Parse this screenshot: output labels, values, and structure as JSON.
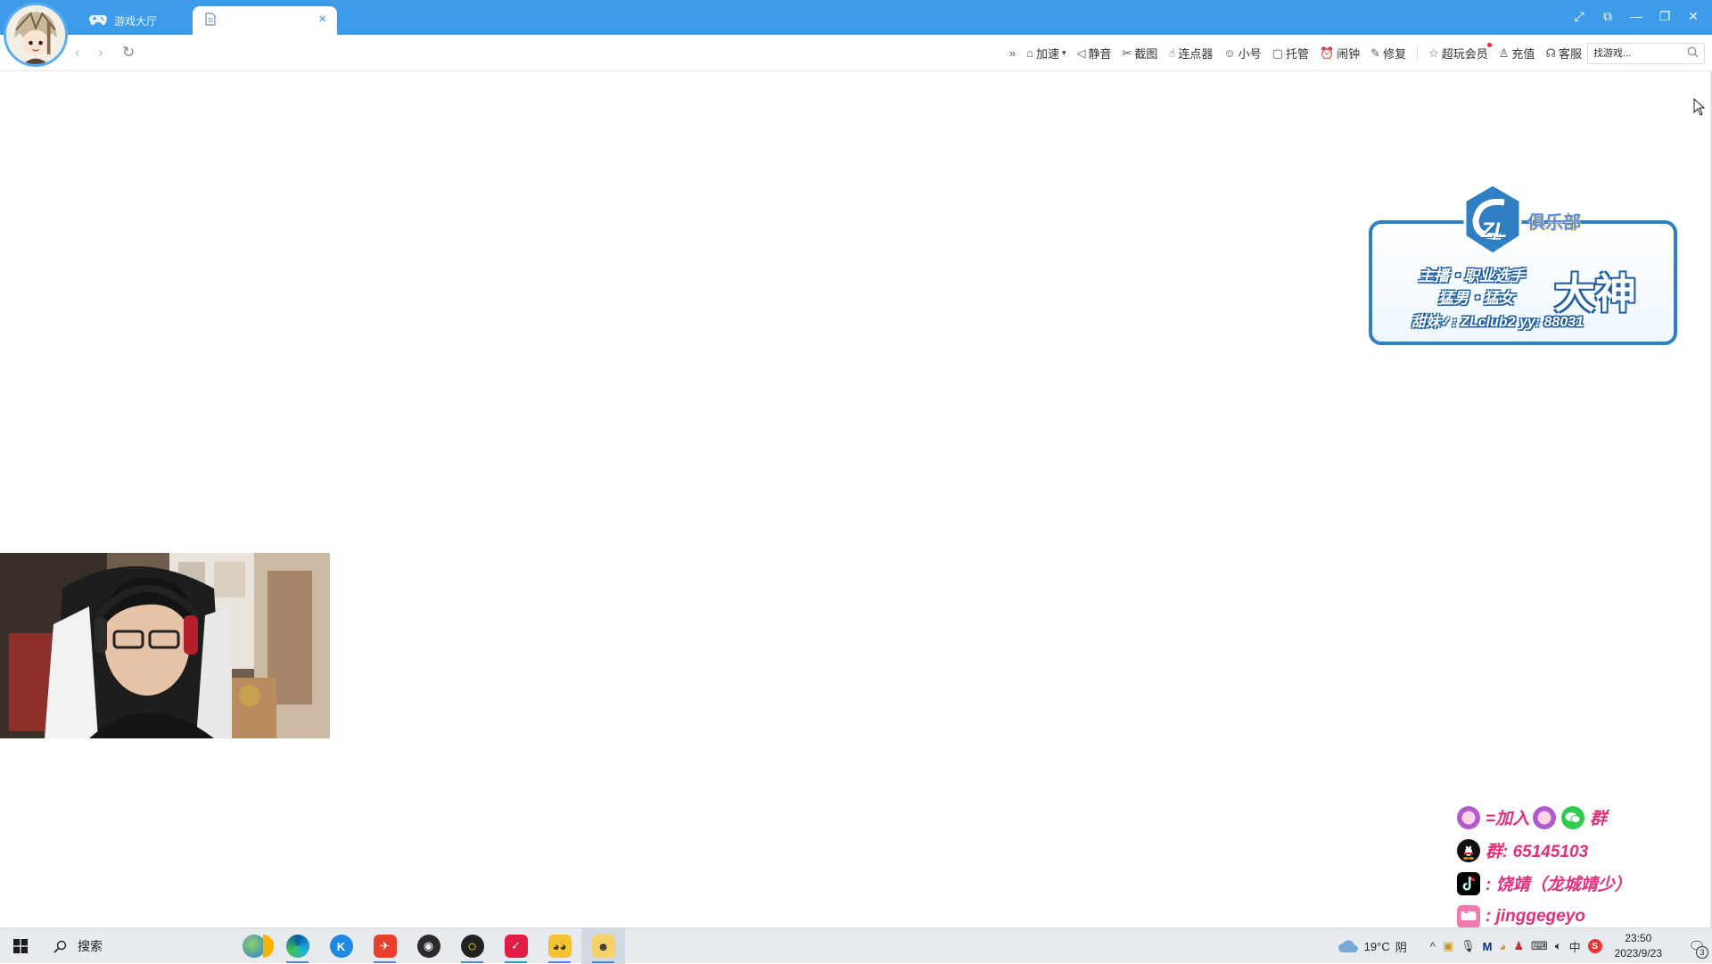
{
  "tabs": {
    "lobby_label": "游戏大厅",
    "active_label": "",
    "close_glyph": "×"
  },
  "window_controls": {
    "fullscreen": "⤢",
    "pin": "⧉",
    "minimize": "—",
    "restore": "❐",
    "close": "✕"
  },
  "nav": {
    "back": "‹",
    "forward": "›",
    "refresh": "↻"
  },
  "toolbar": {
    "more": "»",
    "items": [
      {
        "icon": "⌂",
        "label": "加速",
        "name": "accelerate"
      },
      {
        "icon": "◁",
        "label": "静音",
        "name": "mute"
      },
      {
        "icon": "✂",
        "label": "截图",
        "name": "screenshot"
      },
      {
        "icon": "☝",
        "label": "连点器",
        "name": "auto-clicker"
      },
      {
        "icon": "☺",
        "label": "小号",
        "name": "alt-account"
      },
      {
        "icon": "▢",
        "label": "托管",
        "name": "hosting"
      },
      {
        "icon": "⏰",
        "label": "闹钟",
        "name": "alarm"
      },
      {
        "icon": "✎",
        "label": "修复",
        "name": "repair"
      },
      {
        "icon": "☆",
        "label": "超玩会员",
        "name": "vip"
      },
      {
        "icon": "♙",
        "label": "充值",
        "name": "recharge"
      },
      {
        "icon": "☊",
        "label": "客服",
        "name": "support"
      }
    ],
    "accelerate_caret": "▾",
    "search_placeholder": "找游戏..."
  },
  "club_banner": {
    "logo_text": "ZL",
    "name": "俱乐部",
    "line1": "主播・职业选手",
    "line2": "猛男・猛女",
    "line3": "甜妹✓: ZLclub2   yy: 88031",
    "big": "大神"
  },
  "social": {
    "row1_text": "=加入",
    "row1_suffix": "群",
    "row2_text": "群: 65145103",
    "row3_text": ": 饶靖（龙城靖少）",
    "row4_text": ": jinggegeyo",
    "bili_icon": "bili"
  },
  "taskbar": {
    "search_label": "搜索",
    "weather_temp": "19°C",
    "weather_desc": "阴",
    "ime": "中",
    "time": "23:50",
    "date": "2023/9/23",
    "notifications": "3"
  },
  "colors": {
    "titlebar": "#3d9bea",
    "club_border": "#2f7fc3",
    "social_text": "#e0307a"
  }
}
